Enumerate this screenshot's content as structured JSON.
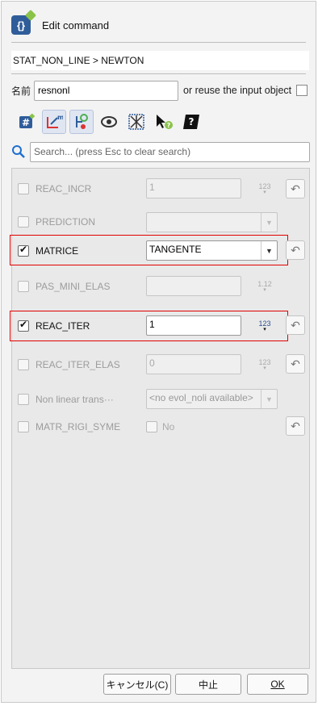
{
  "dialog": {
    "title": "Edit command"
  },
  "breadcrumb": "STAT_NON_LINE > NEWTON",
  "name": {
    "label": "名前",
    "value": "resnonl",
    "reuse_label": "or reuse the input object"
  },
  "toolbar": {
    "icons": [
      "hash-tag-icon",
      "measure-icon",
      "tree-icon",
      "eye-icon",
      "mesh-icon",
      "help-cursor-icon",
      "comment-icon"
    ]
  },
  "search": {
    "placeholder": "Search... (press Esc to clear search)"
  },
  "params": {
    "reac_incr": {
      "label": "REAC_INCR",
      "value": "1",
      "badge": "123"
    },
    "prediction": {
      "label": "PREDICTION",
      "value": ""
    },
    "matrice": {
      "label": "MATRICE",
      "value": "TANGENTE"
    },
    "pas_mini_elas": {
      "label": "PAS_MINI_ELAS",
      "value": "",
      "badge": "1.12"
    },
    "reac_iter": {
      "label": "REAC_ITER",
      "value": "1",
      "badge": "123"
    },
    "reac_iter_elas": {
      "label": "REAC_ITER_ELAS",
      "value": "0",
      "badge": "123"
    },
    "non_linear": {
      "label": "Non linear trans···",
      "value": "<no evol_noli available>"
    },
    "matr_rigi_syme": {
      "label": "MATR_RIGI_SYME",
      "value": "No"
    }
  },
  "footer": {
    "cancel": "キャンセル(C)",
    "abort": "中止",
    "ok": "OK"
  },
  "colors": {
    "highlight": "#e10000",
    "accent": "#2f5d9a"
  }
}
